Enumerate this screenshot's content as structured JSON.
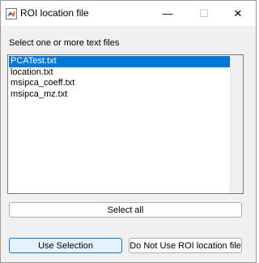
{
  "window": {
    "title": "ROI location file",
    "minimize_glyph": "—",
    "maximize_glyph": "☐",
    "close_glyph": "✕"
  },
  "prompt": "Select one or more text files",
  "files": [
    {
      "name": "PCATest.txt",
      "selected": true
    },
    {
      "name": "location.txt",
      "selected": false
    },
    {
      "name": "msipca_coeff.txt",
      "selected": false
    },
    {
      "name": "msipca_mz.txt",
      "selected": false
    }
  ],
  "buttons": {
    "select_all": "Select all",
    "use_selection": "Use Selection",
    "do_not_use": "Do Not Use ROI location file"
  },
  "colors": {
    "selection": "#0078d7",
    "window_bg": "#f0f0f0"
  }
}
